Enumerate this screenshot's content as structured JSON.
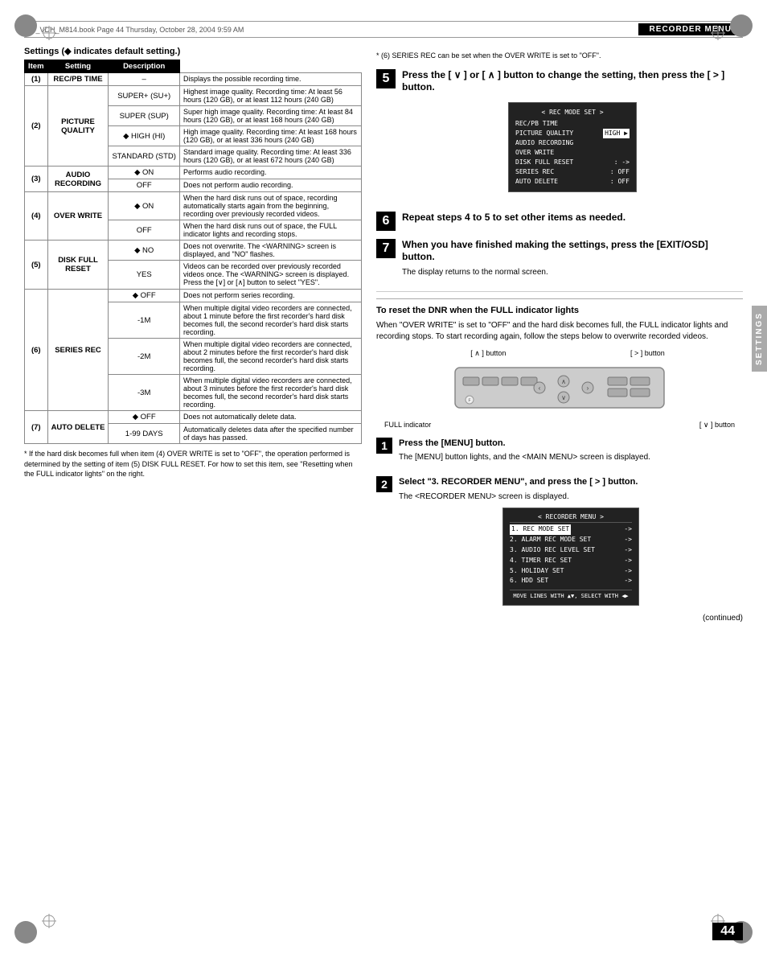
{
  "page": {
    "number": "44",
    "filename": "c00_VDH_M814.book  Page 44  Thursday, October 28, 2004  9:59 AM",
    "header_title": "RECORDER MENU",
    "continued": "(continued)"
  },
  "settings": {
    "label": "Settings (◆ indicates default setting.)",
    "columns": [
      "Item",
      "Setting",
      "Description"
    ],
    "rows": [
      {
        "row_num": "(1)",
        "item": "REC/PB TIME",
        "settings": [
          {
            "value": "–",
            "default": false,
            "desc": "Displays the possible recording time."
          }
        ]
      },
      {
        "row_num": "(2)",
        "item": "PICTURE QUALITY",
        "settings": [
          {
            "value": "SUPER+ (SU+)",
            "default": false,
            "desc": "Highest image quality. Recording time: At least 56 hours (120 GB), or at least 112 hours (240 GB)"
          },
          {
            "value": "SUPER (SUP)",
            "default": false,
            "desc": "Super high image quality. Recording time: At least 84 hours (120 GB), or at least 168 hours (240 GB)"
          },
          {
            "value": "◆ HIGH (HI)",
            "default": true,
            "desc": "High image quality. Recording time: At least 168 hours (120 GB), or at least 336 hours (240 GB)"
          },
          {
            "value": "STANDARD (STD)",
            "default": false,
            "desc": "Standard image quality. Recording time: At least 336 hours (120 GB), or at least 672 hours (240 GB)"
          }
        ]
      },
      {
        "row_num": "(3)",
        "item": "AUDIO RECORDING",
        "settings": [
          {
            "value": "◆ ON",
            "default": true,
            "desc": "Performs audio recording."
          },
          {
            "value": "OFF",
            "default": false,
            "desc": "Does not perform audio recording."
          }
        ]
      },
      {
        "row_num": "(4)",
        "item": "OVER WRITE",
        "settings": [
          {
            "value": "◆ ON",
            "default": true,
            "desc": "When the hard disk runs out of space, recording automatically starts again from the beginning, recording over previously recorded videos."
          },
          {
            "value": "OFF",
            "default": false,
            "desc": "When the hard disk runs out of space, the FULL indicator lights and recording stops."
          }
        ]
      },
      {
        "row_num": "(5)",
        "item": "DISK FULL RESET",
        "settings": [
          {
            "value": "◆ NO",
            "default": true,
            "desc": "Does not overwrite. The <WARNING> screen is displayed, and \"NO\" flashes."
          },
          {
            "value": "YES",
            "default": false,
            "desc": "Videos can be recorded over previously recorded videos once. The <WARNING> screen is displayed. Press the [∨] or [∧] button to select \"YES\"."
          }
        ]
      },
      {
        "row_num": "(6)",
        "item": "SERIES REC",
        "settings": [
          {
            "value": "◆ OFF",
            "default": true,
            "desc": "Does not perform series recording."
          },
          {
            "value": "-1M",
            "default": false,
            "desc": "When multiple digital video recorders are connected, about 1 minute before the first recorder's hard disk becomes full, the second recorder's hard disk starts recording."
          },
          {
            "value": "-2M",
            "default": false,
            "desc": "When multiple digital video recorders are connected, about 2 minutes before the first recorder's hard disk becomes full, the second recorder's hard disk starts recording."
          },
          {
            "value": "-3M",
            "default": false,
            "desc": "When multiple digital video recorders are connected, about 3 minutes before the first recorder's hard disk becomes full, the second recorder's hard disk starts recording."
          }
        ]
      },
      {
        "row_num": "(7)",
        "item": "AUTO DELETE",
        "settings": [
          {
            "value": "◆ OFF",
            "default": true,
            "desc": "Does not automatically delete data."
          },
          {
            "value": "1-99 DAYS",
            "default": false,
            "desc": "Automatically deletes data after the specified number of days has passed."
          }
        ]
      }
    ],
    "footnote1": "* If the hard disk becomes full when item (4) OVER WRITE is set to \"OFF\", the operation performed is determined by the setting of item (5) DISK FULL RESET. For how to set this item, see \"Resetting when the FULL indicator lights\" on the right.",
    "footnote2": "* (6) SERIES REC can be set when the OVER WRITE is set to \"OFF\"."
  },
  "steps": {
    "step5": {
      "number": "5",
      "title": "Press the [ ∨ ] or [ ∧ ] button to change the setting, then press the [ > ] button.",
      "osd": {
        "title": "< REC MODE SET >",
        "rows": [
          {
            "label": "REC/PB TIME",
            "value": ""
          },
          {
            "label": "PICTURE QUALITY",
            "value": "HIGH",
            "highlighted": true
          },
          {
            "label": "AUDIO RECORDING",
            "value": ""
          },
          {
            "label": "OVER WRITE",
            "value": ""
          },
          {
            "label": "DISK FULL RESET",
            "value": "->"
          },
          {
            "label": "SERIES REC",
            "value": ": OFF"
          },
          {
            "label": "AUTO DELETE",
            "value": ": OFF"
          }
        ]
      }
    },
    "step6": {
      "number": "6",
      "title": "Repeat steps 4 to 5 to set other items as needed."
    },
    "step7": {
      "number": "7",
      "title": "When you have finished making the settings, press the [EXIT/OSD] button.",
      "body": "The display returns to the normal screen."
    }
  },
  "dnr_section": {
    "title": "To reset the DNR when the FULL indicator lights",
    "body": "When \"OVER WRITE\" is set to \"OFF\" and the hard disk becomes full, the FULL indicator lights and recording stops. To start recording again, follow the steps below to overwrite recorded videos.",
    "device_labels_top": {
      "left": "[ ∧ ] button",
      "right": "[ > ] button"
    },
    "device_labels_bottom": {
      "left": "FULL indicator",
      "right": "[ ∨ ] button"
    },
    "step1": {
      "number": "1",
      "title": "Press the [MENU] button.",
      "body": "The [MENU] button lights, and the <MAIN MENU> screen is displayed."
    },
    "step2": {
      "number": "2",
      "title": "Select \"3. RECORDER MENU\", and press the [ > ] button.",
      "body": "The <RECORDER MENU> screen is displayed.",
      "osd": {
        "title": "< RECORDER MENU >",
        "rows": [
          {
            "label": "1. REC MODE SET",
            "value": "->",
            "selected": true
          },
          {
            "label": "2. ALARM REC MODE SET",
            "value": "->"
          },
          {
            "label": "3. AUDIO REC LEVEL SET",
            "value": "->"
          },
          {
            "label": "4. TIMER REC SET",
            "value": "->"
          },
          {
            "label": "5. HOLIDAY SET",
            "value": "->"
          },
          {
            "label": "6. HDD SET",
            "value": "->"
          }
        ],
        "footer": "MOVE LINES WITH ◆◆, SELECT WITH ◆◆"
      }
    }
  },
  "sidebar": {
    "label": "SETTINGS"
  }
}
